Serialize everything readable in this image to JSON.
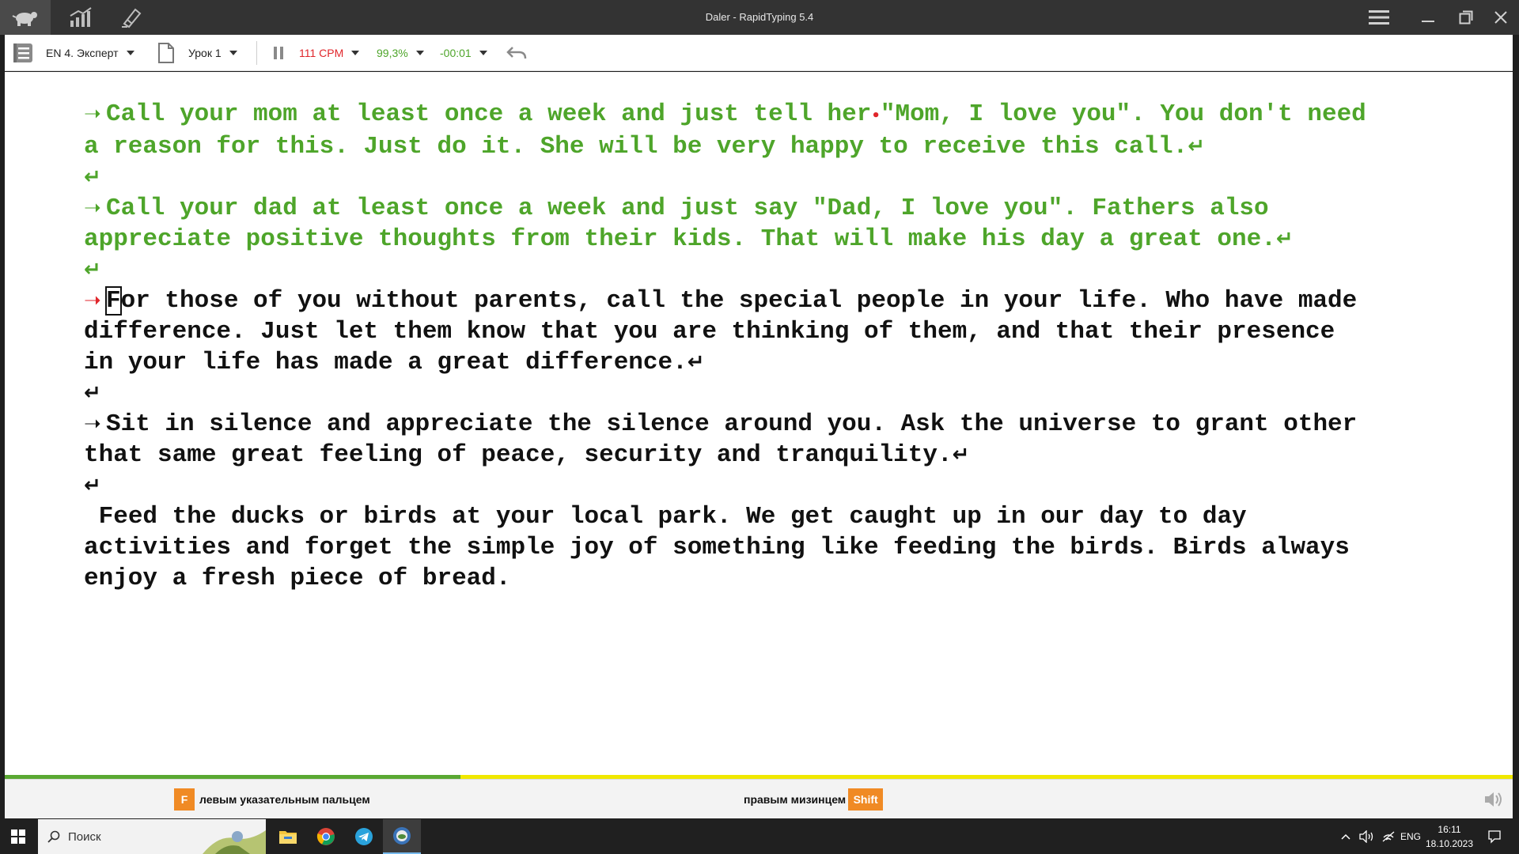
{
  "window": {
    "title": "Daler - RapidTyping 5.4"
  },
  "titlebar_icons": [
    "turtle-logo-icon",
    "statistics-icon",
    "lesson-editor-icon"
  ],
  "toolbar": {
    "course": "EN 4. Эксперт",
    "lesson": "Урок 1",
    "speed": "111 CPM",
    "accuracy": "99,3%",
    "time": "-00:01",
    "colors": {
      "speed": "#e0262b",
      "accuracy": "#4ea52a",
      "time": "#4ea52a"
    }
  },
  "paragraphs": [
    {
      "state": "typed",
      "line1": "Call your mom at least once a week and just tell her",
      "line1_rest": "\"Mom, I love you\". You don't need",
      "line2": "a reason for this. Just do it. She will be very happy to receive this call."
    },
    {
      "state": "typed",
      "line1": "Call your dad at least once a week and just say \"Dad, I love you\". Fathers also",
      "line2": "appreciate positive thoughts from their kids. That will make his day a great one."
    },
    {
      "state": "current",
      "cursor_char": "F",
      "line1": "or those of you without parents, call the special people in your life. Who have made",
      "line2": "difference. Just let them know that you are thinking of them, and that their presence",
      "line3": "in your life has made a great difference."
    },
    {
      "state": "pending",
      "line1": "Sit in silence and appreciate the silence around you. Ask the universe to grant other",
      "line2": "that same great feeling of peace, security and tranquility."
    },
    {
      "state": "pending",
      "line1": " Feed the ducks or birds at your local park. We get caught up in our day to day",
      "line2": "activities and forget the simple joy of something like feeding the birds. Birds always",
      "line3": "enjoy a fresh piece of bread."
    }
  ],
  "progress": {
    "fraction": 0.302
  },
  "hints": {
    "left_key": "F",
    "left_text": "левым указательным пальцем",
    "right_text": "правым мизинцем",
    "right_key": "Shift"
  },
  "taskbar": {
    "search_placeholder": "Поиск",
    "apps": [
      "file-explorer-icon",
      "chrome-icon",
      "telegram-icon",
      "rapidtyping-icon"
    ],
    "language": "ENG",
    "time": "16:11",
    "date": "18.10.2023"
  }
}
